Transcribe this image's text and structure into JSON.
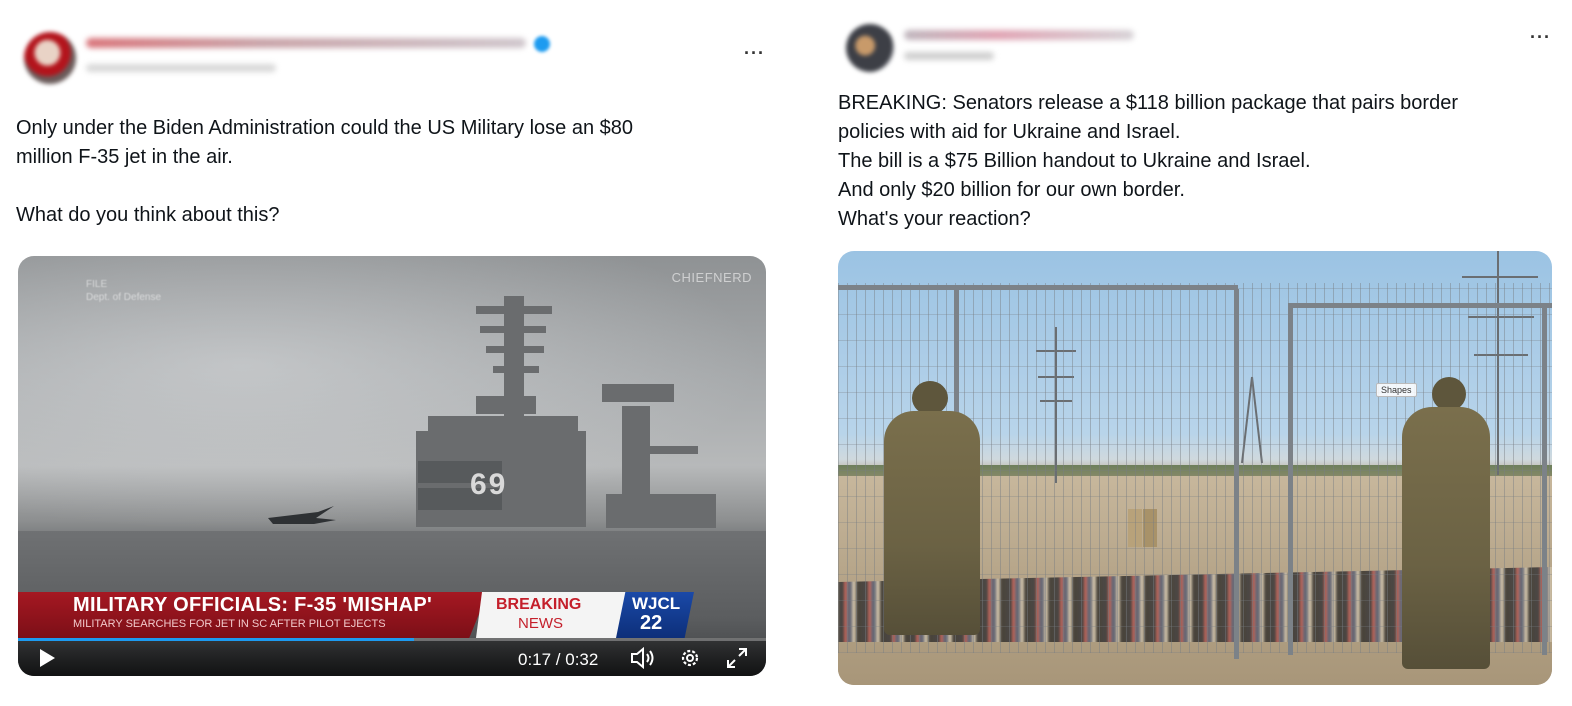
{
  "left_tweet": {
    "text": "Only under the Biden Administration could the US Military lose an $80\nmillion F-35 jet in the air.\n\nWhat do you think about this?",
    "more_menu": "···",
    "video": {
      "source_watermark": "CHIEFNERD",
      "file_tag_line1": "FILE",
      "file_tag_line2": "Dept. of Defense",
      "headline": "MILITARY OFFICIALS: F-35 'MISHAP'",
      "subheadline": "MILITARY SEARCHES FOR JET IN SC AFTER PILOT EJECTS",
      "breaking": "BREAKING",
      "news": "NEWS",
      "callsign": "WJCL",
      "channel": "22",
      "time": "0:17 / 0:32",
      "progress": 0.53,
      "hull_number": "69"
    }
  },
  "right_tweet": {
    "text": "BREAKING: Senators release a $118 billion package that pairs border\npolicies with aid for Ukraine and Israel.\nThe bill is a $75 Billion handout to Ukraine and Israel.\nAnd only $20 billion for our own border.\nWhat's your reaction?",
    "more_menu": "···",
    "photo": {
      "tag": "Shapes"
    }
  }
}
